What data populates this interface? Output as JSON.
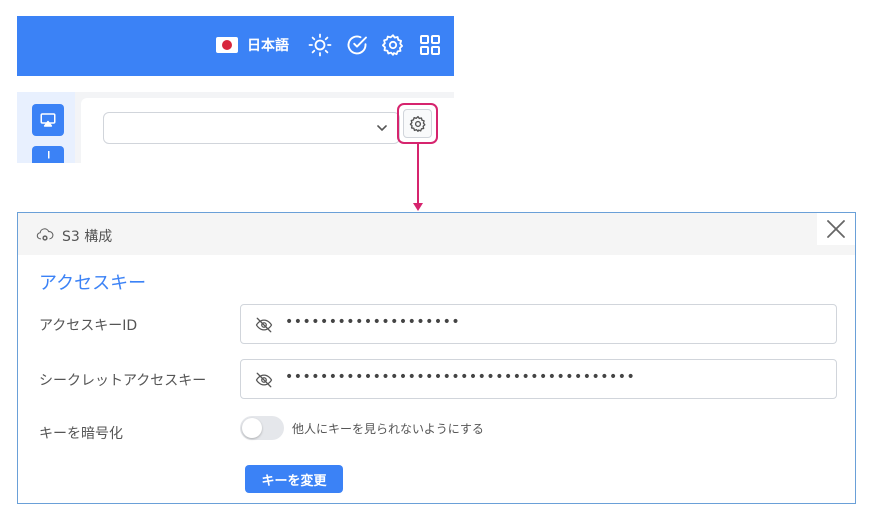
{
  "header": {
    "language_label": "日本語",
    "icons": [
      "flag-japan-icon",
      "sun-icon",
      "check-circle-icon",
      "gear-icon",
      "grid-icon"
    ],
    "accent_color": "#3b82f6"
  },
  "sidebar": {
    "items": [
      "airplay-icon",
      "chart-icon"
    ]
  },
  "toolbar": {
    "select_value": "",
    "settings_icon": "gear-icon",
    "highlight_color": "#d6246e"
  },
  "dialog": {
    "title": "S3 構成",
    "title_icon": "cloud-gear-icon",
    "section_title": "アクセスキー",
    "access_key": {
      "label": "アクセスキーID",
      "value": "••••••••••••••••••••"
    },
    "secret_key": {
      "label": "シークレットアクセスキー",
      "value": "••••••••••••••••••••••••••••••••••••••••"
    },
    "encrypt": {
      "label": "キーを暗号化",
      "toggle_text": "他人にキーを見られないようにする",
      "enabled": false
    },
    "change_button_label": "キーを変更"
  }
}
